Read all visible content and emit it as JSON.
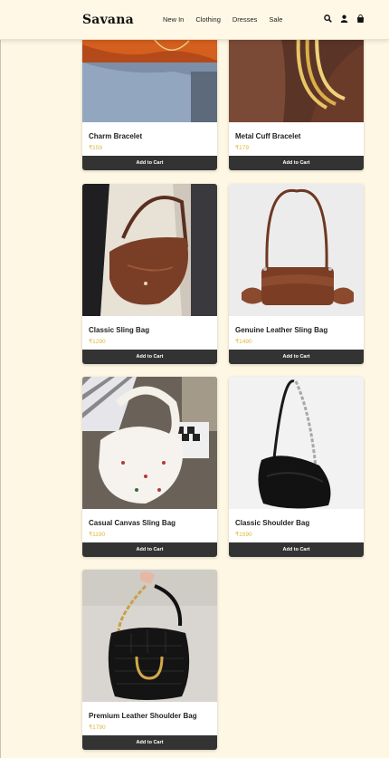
{
  "header": {
    "logo": "Savana",
    "nav": [
      "New In",
      "Clothing",
      "Dresses",
      "Sale"
    ],
    "icons": [
      "search-icon",
      "user-icon",
      "bag-icon"
    ]
  },
  "colors": {
    "background": "#fdf7e4",
    "price": "#e0b63a",
    "button": "#333333"
  },
  "products": [
    {
      "name": "Charm Bracelet",
      "price": "₹159",
      "button": "Add to Cart"
    },
    {
      "name": "Metal Cuff Bracelet",
      "price": "₹179",
      "button": "Add to Cart"
    },
    {
      "name": "Classic Sling Bag",
      "price": "₹1290",
      "button": "Add to Cart"
    },
    {
      "name": "Genuine Leather Sling Bag",
      "price": "₹1490",
      "button": "Add to Cart"
    },
    {
      "name": "Casual Canvas Sling Bag",
      "price": "₹1190",
      "button": "Add to Cart"
    },
    {
      "name": "Classic Shoulder Bag",
      "price": "₹1590",
      "button": "Add to Cart"
    },
    {
      "name": "Premium Leather Shoulder Bag",
      "price": "₹1790",
      "button": "Add to Cart"
    }
  ]
}
